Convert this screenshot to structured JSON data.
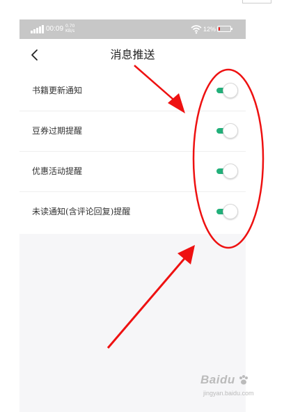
{
  "status_bar": {
    "time": "00:09",
    "net_speed": "0.70 KB/s",
    "battery_percent": "12%",
    "battery_level": 0.12,
    "battery_color": "#ee1111"
  },
  "navbar": {
    "back_icon": "chevron-left-icon",
    "title": "消息推送"
  },
  "settings": [
    {
      "label": "书籍更新通知",
      "enabled": true
    },
    {
      "label": "豆券过期提醒",
      "enabled": true
    },
    {
      "label": "优惠活动提醒",
      "enabled": true
    },
    {
      "label": "未读通知(含评论回复)提醒",
      "enabled": true
    }
  ],
  "colors": {
    "toggle_on": "#22b07a",
    "annotation": "#ee1111"
  },
  "watermark": {
    "brand": "Baidu",
    "subtitle": "jingyan.baidu.com"
  }
}
